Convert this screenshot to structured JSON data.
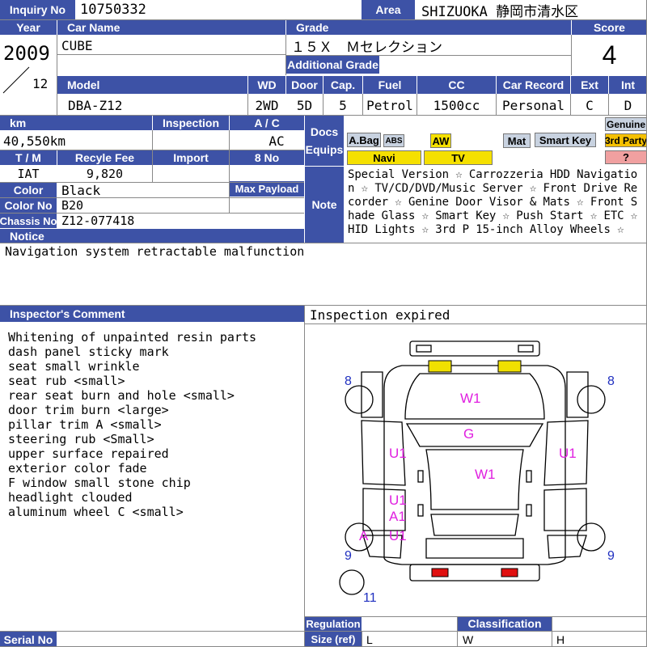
{
  "labels": {
    "inquiry_no": "Inquiry No",
    "area": "Area",
    "year": "Year",
    "car_name": "Car Name",
    "grade": "Grade",
    "score": "Score",
    "additional_grade": "Additional Grade",
    "model": "Model",
    "wd": "WD",
    "door": "Door",
    "cap": "Cap.",
    "fuel": "Fuel",
    "cc": "CC",
    "car_record": "Car Record",
    "ext": "Ext",
    "int": "Int",
    "km": "km",
    "inspection": "Inspection",
    "ac": "A / C",
    "docs": "Docs",
    "equips": "Equips",
    "tm": "T / M",
    "recycle_fee": "Recyle Fee",
    "import": "Import",
    "no8": "8 No",
    "color": "Color",
    "max_payload": "Max Payload",
    "color_no": "Color No",
    "chassis_no": "Chassis No",
    "notice": "Notice",
    "note": "Note",
    "inspectors_comment": "Inspector's Comment",
    "regulation": "Regulation",
    "classification": "Classification",
    "size_ref": "Size (ref)",
    "serial_no": "Serial No"
  },
  "vehicle": {
    "inquiry_no": "10750332",
    "area": "SHIZUOKA 静岡市清水区",
    "year": "2009",
    "month": "12",
    "car_name": "CUBE",
    "grade": "１５Ｘ　Ｍセレクション",
    "score": "4",
    "model": "DBA-Z12",
    "wd": "2WD",
    "door": "5D",
    "cap": "5",
    "fuel": "Petrol",
    "cc": "1500cc",
    "car_record": "Personal",
    "ext": "C",
    "int": "D",
    "km": "40,550km",
    "ac": "AC",
    "tm": "IAT",
    "recycle_fee": "9,820",
    "color": "Black",
    "color_no": "B20",
    "chassis_no": "Z12-077418"
  },
  "equips": {
    "abag": "A.Bag",
    "abs": "ABS",
    "aw": "AW",
    "mat": "Mat",
    "smart_key": "Smart Key",
    "genuine": "Genuine",
    "navi": "Navi",
    "tv": "TV",
    "third_party": "3rd Party",
    "question": "?"
  },
  "note_text": "Special Version ☆ Carrozzeria HDD Navigation ☆ TV/CD/DVD/Music Server ☆ Front Drive Recorder ☆ Genine Door Visor & Mats ☆ Front Shade Glass ☆ Smart Key ☆ Push Start ☆ ETC ☆ HID Lights ☆ 3rd P 15-inch Alloy Wheels ☆",
  "notice_text": "Navigation system retractable malfunction",
  "inspection_status": "Inspection expired",
  "comments": [
    "Whitening of unpainted resin parts",
    "dash panel sticky mark",
    "seat small wrinkle",
    "seat rub <small>",
    "rear seat burn and hole <small>",
    "door trim burn <large>",
    "pillar trim A <small>",
    "steering rub <Small>",
    "upper surface repaired",
    "exterior color fade",
    "F window small stone chip",
    "headlight clouded",
    "aluminum wheel C <small>"
  ],
  "diagram_marks": {
    "hood": "W1",
    "front_glass": "G",
    "roof": "W1",
    "left_front_door": "U1",
    "right_front_door": "U1",
    "left_rear_door": "U1",
    "left_rear_door_2": "A1",
    "left_rear_quarter": "U1",
    "left_rear_wheel": "A",
    "front_left_tire": "8",
    "front_right_tire": "8",
    "rear_left_tire": "9",
    "rear_right_tire": "9",
    "spare_tire": "11"
  },
  "size_ref": {
    "l": "L",
    "w": "W",
    "h": "H"
  },
  "colors": {
    "label_bg": "#3d52a6",
    "mark_magenta": "#e020e0",
    "mark_blue": "#2030c0",
    "headlight_yellow": "#f0e000",
    "taillight_red": "#e01010"
  }
}
